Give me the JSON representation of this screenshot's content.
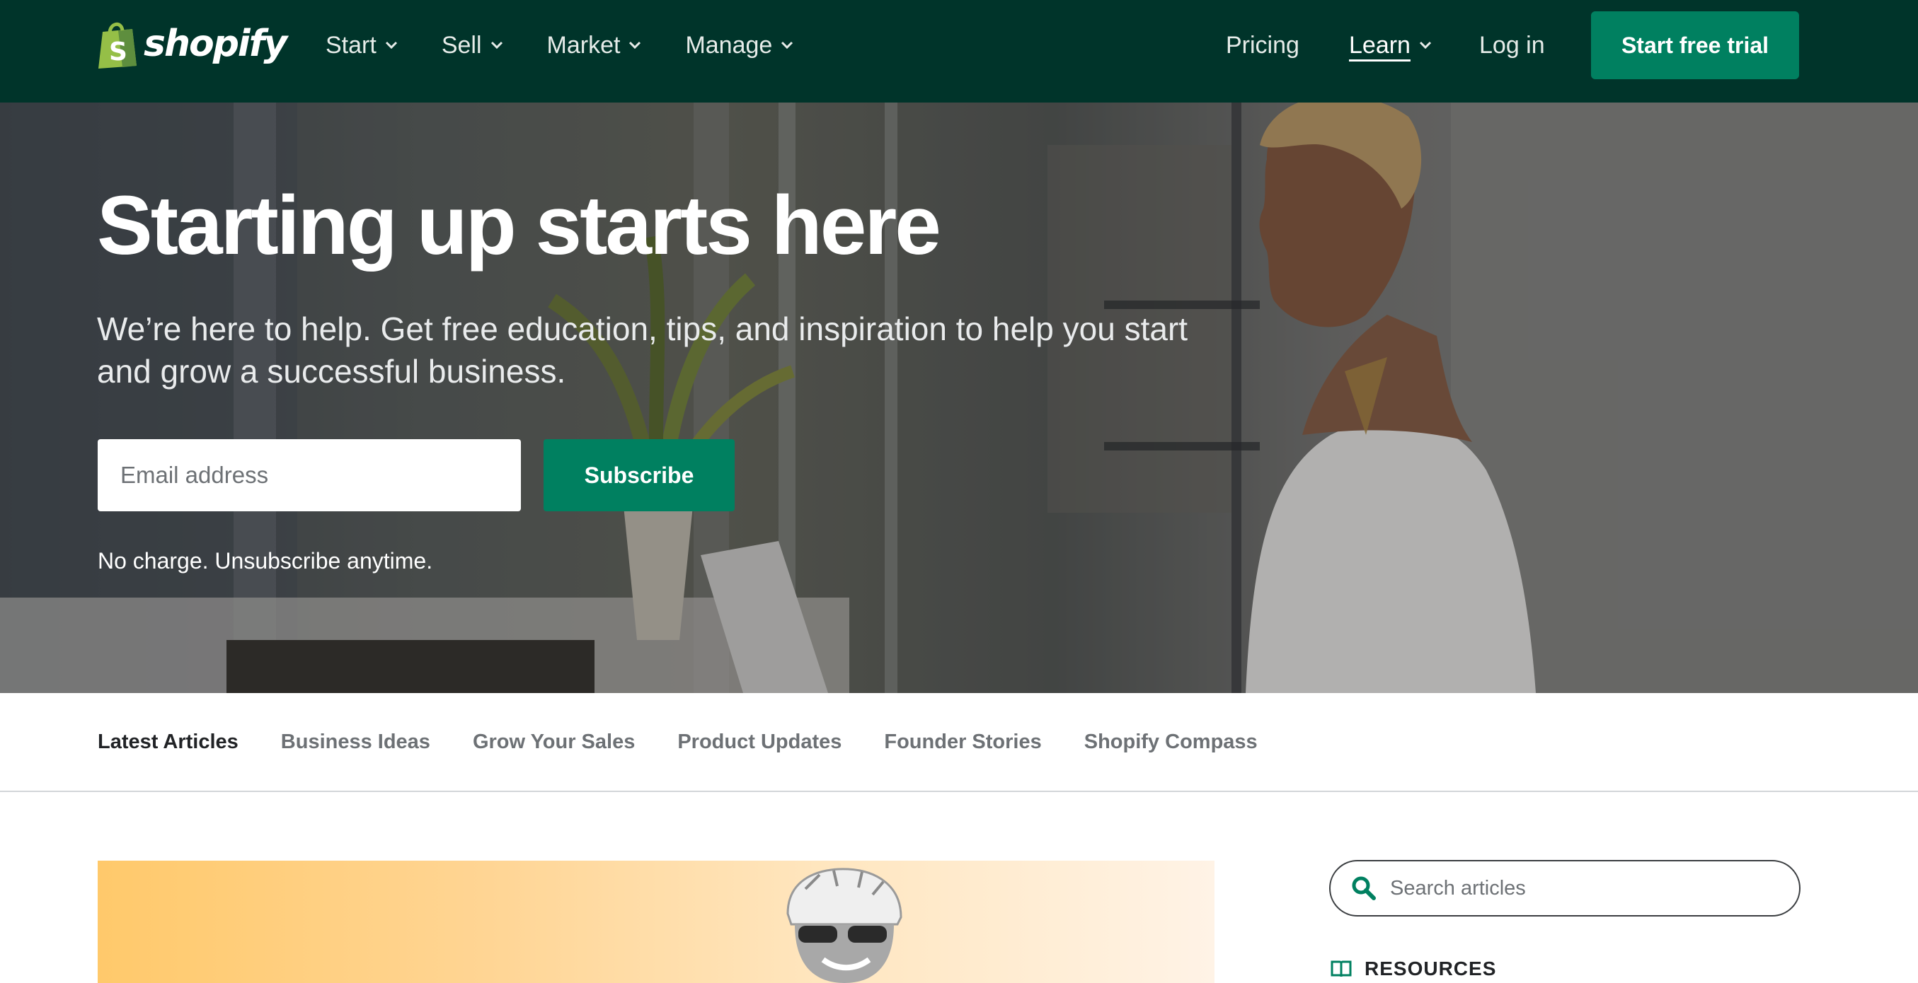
{
  "brand": {
    "name": "shopify",
    "logo_letter": "S",
    "colors": {
      "nav_bg": "#00342a",
      "accent": "#008060",
      "logo_green": "#95bf47"
    }
  },
  "nav": {
    "menu": [
      {
        "label": "Start",
        "icon": "chevron-down-icon"
      },
      {
        "label": "Sell",
        "icon": "chevron-down-icon"
      },
      {
        "label": "Market",
        "icon": "chevron-down-icon"
      },
      {
        "label": "Manage",
        "icon": "chevron-down-icon"
      }
    ],
    "pricing": "Pricing",
    "learn": "Learn",
    "login": "Log in",
    "cta": "Start free trial"
  },
  "hero": {
    "title": "Starting up starts here",
    "subtitle": "We’re here to help. Get free education, tips, and inspiration to help you start and grow a successful business.",
    "email_placeholder": "Email address",
    "subscribe_label": "Subscribe",
    "note": "No charge. Unsubscribe anytime."
  },
  "tabs": [
    {
      "label": "Latest Articles",
      "active": true
    },
    {
      "label": "Business Ideas",
      "active": false
    },
    {
      "label": "Grow Your Sales",
      "active": false
    },
    {
      "label": "Product Updates",
      "active": false
    },
    {
      "label": "Founder Stories",
      "active": false
    },
    {
      "label": "Shopify Compass",
      "active": false
    }
  ],
  "sidebar": {
    "search_placeholder": "Search articles",
    "search_icon": "search-icon",
    "resources_label": "RESOURCES",
    "resources_icon": "book-icon"
  }
}
